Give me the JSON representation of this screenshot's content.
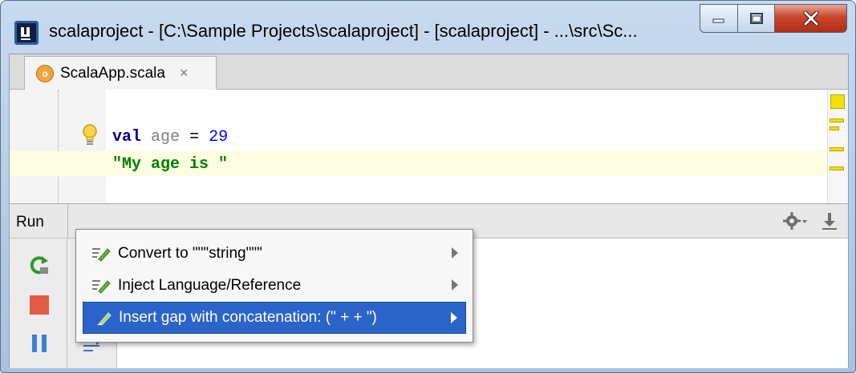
{
  "window": {
    "title": "scalaproject - [C:\\Sample Projects\\scalaproject] - [scalaproject] - ...\\src\\Sc...",
    "icons": {
      "app": "intellij-icon",
      "minimize": "minimize-icon",
      "maximize": "maximize-icon",
      "close": "close-icon"
    }
  },
  "tabs": [
    {
      "label": "ScalaApp.scala",
      "icon_letter": "o",
      "close": "×"
    }
  ],
  "editor": {
    "line1": {
      "keyword": "val",
      "identifier": "age",
      "operator": "=",
      "number": "29"
    },
    "line2": {
      "string": "\"My age is \""
    },
    "intention_icon": "lightbulb-icon"
  },
  "run_panel": {
    "label": "Run",
    "toolbar_icons": [
      "rerun-icon",
      "stop-icon",
      "pause-icon"
    ],
    "secondary_icons": [
      "scroll-down-icon",
      "soft-wrap-icon"
    ],
    "right_icons": [
      "gear-icon",
      "pin-icon"
    ]
  },
  "popup_menu": {
    "items": [
      {
        "label": "Convert to \"\"\"string\"\"\"",
        "selected": false
      },
      {
        "label": "Inject Language/Reference",
        "selected": false
      },
      {
        "label": "Insert gap with concatenation: (\" +  + \")",
        "selected": true
      }
    ]
  },
  "colors": {
    "keyword": "#000080",
    "number": "#0000ff",
    "string": "#008000",
    "selection": "#2a64c9",
    "current_line": "#fdfde2"
  }
}
